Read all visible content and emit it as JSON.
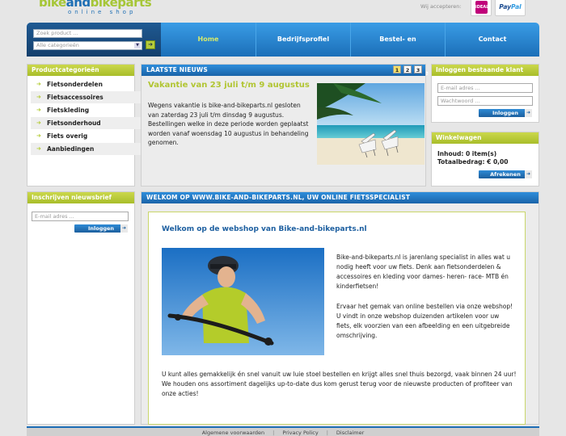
{
  "header": {
    "logo_main_a": "bike",
    "logo_main_and": "and",
    "logo_main_b": "bikeparts",
    "logo_tag": "online shop",
    "accept_label": "Wij accepteren:",
    "pay_ideal": "iDEAL",
    "pay_paypal_a": "Pay",
    "pay_paypal_b": "Pal"
  },
  "search": {
    "placeholder": "Zoek product ...",
    "category_selected": "Alle categorieën",
    "go_symbol": "➜"
  },
  "nav": {
    "items": [
      {
        "label": "Home"
      },
      {
        "label": "Bedrijfsprofiel"
      },
      {
        "label": "Bestel- en betaalinformatie"
      },
      {
        "label": "Contact"
      }
    ]
  },
  "categories": {
    "title": "Productcategorieën",
    "items": [
      {
        "label": "Fietsonderdelen"
      },
      {
        "label": "Fietsaccessoires"
      },
      {
        "label": "Fietskleding"
      },
      {
        "label": "Fietsonderhoud"
      },
      {
        "label": "Fiets overig"
      },
      {
        "label": "Aanbiedingen"
      }
    ]
  },
  "newsletter": {
    "title": "Inschrijven nieuwsbrief",
    "email_placeholder": "E-mail adres ...",
    "button": "Inloggen"
  },
  "news": {
    "header": "LAATSTE NIEUWS",
    "pages": [
      "1",
      "2",
      "3"
    ],
    "title": "Vakantie van 23 juli t/m 9 augustus",
    "body": "Wegens vakantie is bike-and-bikeparts.nl gesloten van zaterdag 23 juli t/m dinsdag 9 augustus. Bestellingen welke in deze periode worden geplaatst worden vanaf woensdag 10 augustus in behandeling genomen."
  },
  "login": {
    "title": "Inloggen bestaande klant",
    "email_placeholder": "E-mail adres ...",
    "password_placeholder": "Wachtwoord ...",
    "button": "Inloggen"
  },
  "cart": {
    "title": "Winkelwagen",
    "contents": "Inhoud: 0 item(s)",
    "total": "Totaalbedrag: € 0,00",
    "button": "Afrekenen"
  },
  "welcome": {
    "header": "WELKOM OP WWW.BIKE-AND-BIKEPARTS.NL, UW ONLINE FIETSSPECIALIST",
    "title": "Welkom op de webshop van Bike-and-bikeparts.nl",
    "p1": "Bike-and-bikeparts.nl is jarenlang specialist in alles wat u nodig heeft voor uw fiets. Denk aan fietsonderdelen & accessoires en kleding voor dames- heren- race- MTB én kinderfietsen!",
    "p2": "Ervaar het gemak van online bestellen via onze webshop! U vindt in onze webshop duizenden artikelen voor uw fiets, elk voorzien van een afbeelding en een uitgebreide omschrijving.",
    "p3": "U kunt alles gemakkelijk én snel vanuit uw luie stoel bestellen en krijgt alles snel thuis bezorgd, vaak binnen 24 uur! We houden ons assortiment dagelijks up-to-date dus kom gerust terug voor de nieuwste producten of profiteer van onze acties!"
  },
  "footer": {
    "links": [
      "Algemene voorwaarden",
      "Privacy Policy",
      "Disclaimer"
    ],
    "separator": "|"
  },
  "colors": {
    "brand_green": "#a6c637",
    "brand_blue": "#1f6fb4"
  }
}
